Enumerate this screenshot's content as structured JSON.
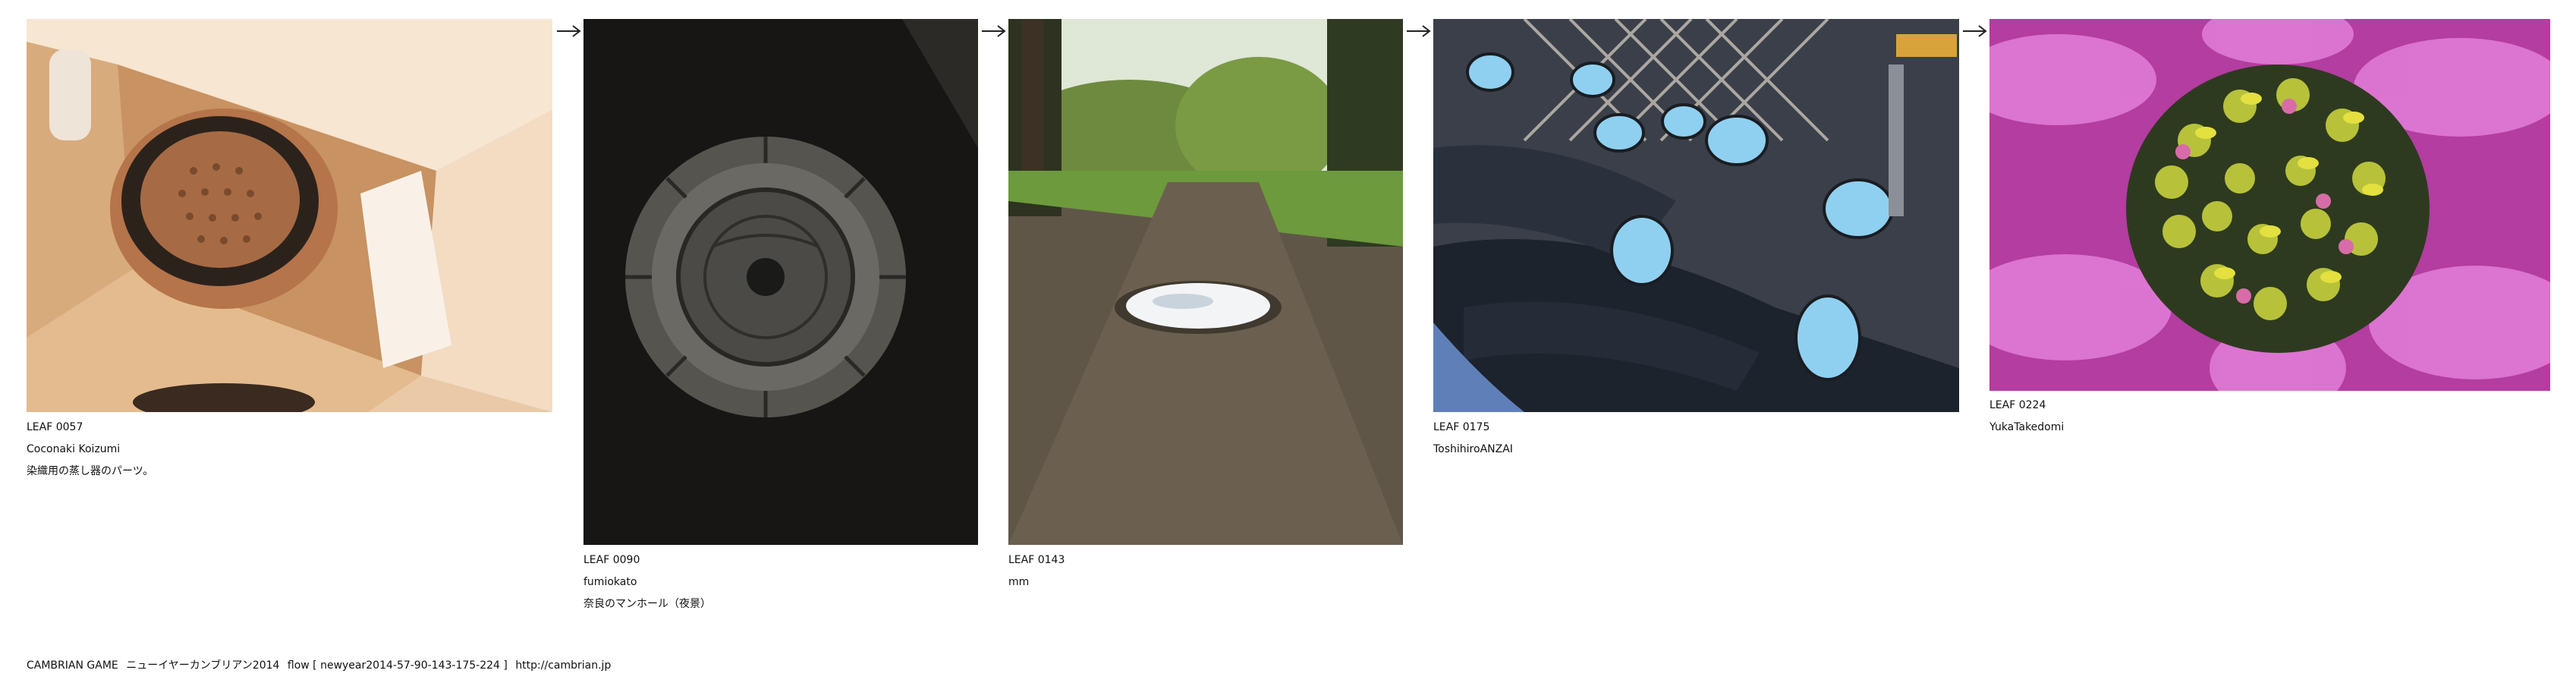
{
  "flow": {
    "items": [
      {
        "leaf": "LEAF 0057",
        "author": "Coconaki Koizumi",
        "caption": "染織用の蒸し器のパーツ。",
        "image": "steamer-part-in-cardboard-box"
      },
      {
        "leaf": "LEAF 0090",
        "author": "fumiokato",
        "caption": "奈良のマンホール（夜景）",
        "image": "manhole-cover-at-night"
      },
      {
        "leaf": "LEAF 0143",
        "author": "mm",
        "caption": "",
        "image": "puddle-on-forest-path"
      },
      {
        "leaf": "LEAF 0175",
        "author": "ToshihiroANZAI",
        "caption": "",
        "image": "parked-scooters-blue-mirrors"
      },
      {
        "leaf": "LEAF 0224",
        "author": "YukaTakedomi",
        "caption": "",
        "image": "pink-flower-closeup"
      }
    ],
    "arrow_icon": "right-arrow-icon"
  },
  "footer": {
    "game": "CAMBRIAN GAME",
    "title": "ニューイヤーカンブリアン2014",
    "flow_label": "flow [ newyear2014-57-90-143-175-224 ]",
    "url": "http://cambrian.jp"
  }
}
